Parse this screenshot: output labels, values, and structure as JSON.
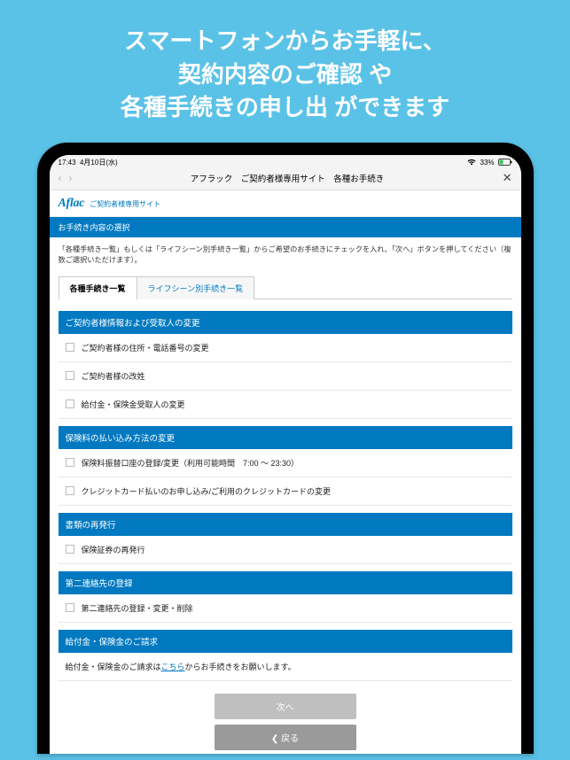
{
  "promo": {
    "line1": "スマートフォンからお手軽に、",
    "line2": "契約内容のご確認 や",
    "line3": "各種手続きの申し出 ができます"
  },
  "statusbar": {
    "time": "17:43",
    "date": "4月10日(水)",
    "battery": "33%"
  },
  "navbar": {
    "title": "アフラック　ご契約者様専用サイト　各種お手続き"
  },
  "brand": {
    "logo": "Aflac",
    "sub": "ご契約者様専用サイト"
  },
  "page_header": "お手続き内容の選択",
  "instruction": "「各種手続き一覧」もしくは「ライフシーン別手続き一覧」からご希望のお手続きにチェックを入れ、「次へ」ボタンを押してください（複数ご選択いただけます）。",
  "tabs": [
    {
      "label": "各種手続き一覧",
      "active": true
    },
    {
      "label": "ライフシーン別手続き一覧",
      "active": false
    }
  ],
  "sections": [
    {
      "title": "ご契約者様情報および受取人の変更",
      "items": [
        {
          "label": "ご契約者様の住所・電話番号の変更"
        },
        {
          "label": "ご契約者様の改姓"
        },
        {
          "label": "給付金・保険金受取人の変更"
        }
      ]
    },
    {
      "title": "保険料の払い込み方法の変更",
      "items": [
        {
          "label": "保険料振替口座の登録/変更（利用可能時間　7:00 ～ 23:30）"
        },
        {
          "label": "クレジットカード払いのお申し込み/ご利用のクレジットカードの変更"
        }
      ]
    },
    {
      "title": "書類の再発行",
      "items": [
        {
          "label": "保険証券の再発行"
        }
      ]
    },
    {
      "title": "第二連絡先の登録",
      "items": [
        {
          "label": "第二連絡先の登録・変更・削除"
        }
      ]
    },
    {
      "title": "給付金・保険金のご請求",
      "note": {
        "pre": "給付金・保険金のご請求は",
        "link": "こちら",
        "post": "からお手続きをお願いします。"
      }
    }
  ],
  "buttons": {
    "next": "次へ",
    "back": "❮ 戻る"
  }
}
